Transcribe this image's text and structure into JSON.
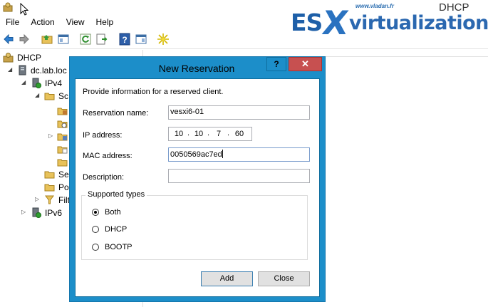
{
  "window": {
    "title": "DHCP"
  },
  "watermark": {
    "url": "www.vladan.fr",
    "part1": "ES",
    "part2": "X",
    "part3": "virtualization",
    "color": "#1e5fa8"
  },
  "menu": [
    "File",
    "Action",
    "View",
    "Help"
  ],
  "toolbar": {
    "icons": [
      "back-arrow-icon",
      "forward-arrow-icon",
      "folder-up-icon",
      "show-hide-pane-icon",
      "refresh-icon",
      "export-list-icon",
      "help-icon",
      "properties-icon",
      "new-star-icon"
    ]
  },
  "tree": {
    "root": "DHCP",
    "server": "dc.lab.loc",
    "ipv4": "IPv4",
    "scope": "Sc",
    "server_options": "Ser",
    "policies": "Po",
    "filters": "Filt",
    "ipv6": "IPv6"
  },
  "dialog": {
    "title": "New Reservation",
    "help_glyph": "?",
    "close_glyph": "✕",
    "intro": "Provide information for a reserved client.",
    "reservation_name": {
      "label": "Reservation name:",
      "value": "vesxi6-01"
    },
    "ip_address": {
      "label": "IP address:",
      "segments": [
        "10",
        "10",
        "7",
        "60"
      ]
    },
    "mac_address": {
      "label": "MAC address:",
      "value": "0050569ac7ed"
    },
    "description": {
      "label": "Description:",
      "value": ""
    },
    "supported_types": {
      "legend": "Supported types",
      "options": [
        "Both",
        "DHCP",
        "BOOTP"
      ],
      "selected": "Both"
    },
    "buttons": {
      "add": "Add",
      "close": "Close"
    },
    "title_bar_color": "#1c8ec9"
  }
}
